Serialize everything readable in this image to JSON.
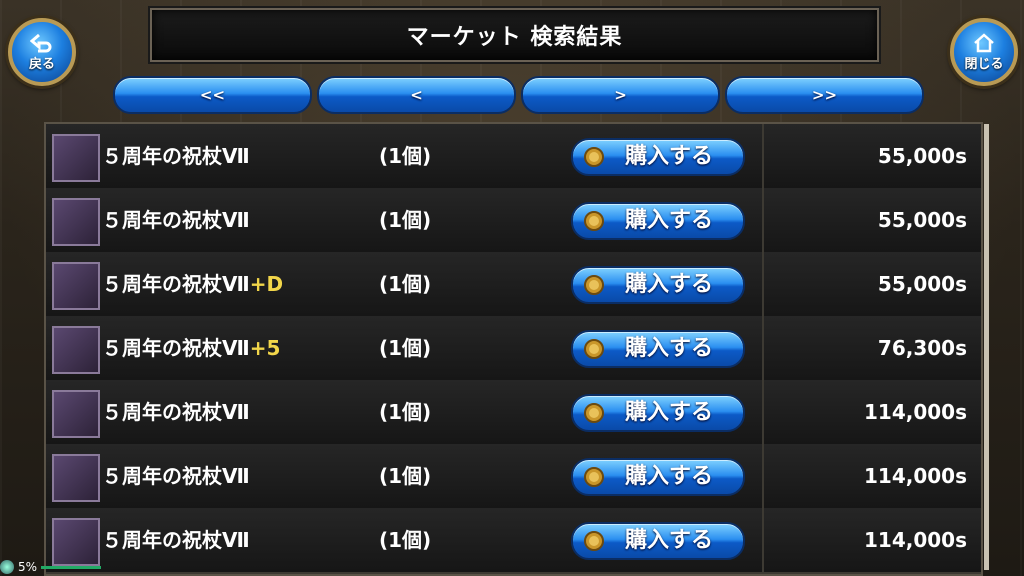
{
  "header": {
    "title": "マーケット 検索結果",
    "back_label": "戻る",
    "close_label": "閉じる"
  },
  "pager": [
    "<<",
    "<",
    ">",
    ">>"
  ],
  "buy_label": "購入する",
  "items": [
    {
      "name": "５周年の祝杖Ⅶ",
      "suffix": "",
      "qty": "(1個)",
      "price": "55,000s"
    },
    {
      "name": "５周年の祝杖Ⅶ",
      "suffix": "",
      "qty": "(1個)",
      "price": "55,000s"
    },
    {
      "name": "５周年の祝杖Ⅶ",
      "suffix": "+D",
      "qty": "(1個)",
      "price": "55,000s"
    },
    {
      "name": "５周年の祝杖Ⅶ",
      "suffix": "+5",
      "qty": "(1個)",
      "price": "76,300s"
    },
    {
      "name": "５周年の祝杖Ⅶ",
      "suffix": "",
      "qty": "(1個)",
      "price": "114,000s"
    },
    {
      "name": "５周年の祝杖Ⅶ",
      "suffix": "",
      "qty": "(1個)",
      "price": "114,000s"
    },
    {
      "name": "５周年の祝杖Ⅶ",
      "suffix": "",
      "qty": "(1個)",
      "price": "114,000s"
    }
  ],
  "status": {
    "battery": "5%"
  },
  "colors": {
    "accent": "#2b8ff0",
    "suffix": "#f2d64a"
  }
}
